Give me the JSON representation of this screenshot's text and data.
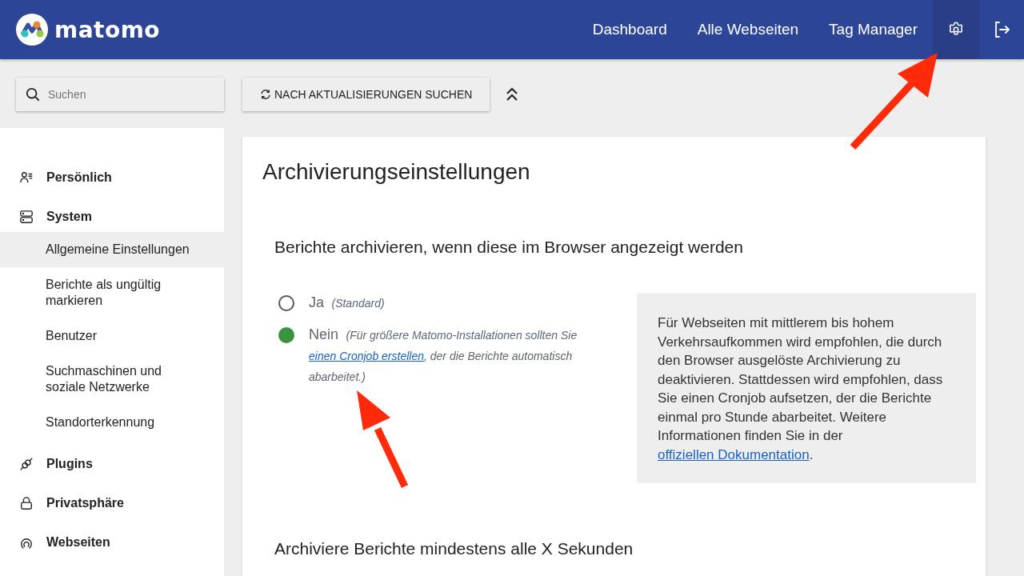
{
  "header": {
    "logo_text": "matomo",
    "nav": [
      {
        "label": "Dashboard"
      },
      {
        "label": "Alle Webseiten"
      },
      {
        "label": "Tag Manager"
      }
    ],
    "settings_active": true
  },
  "toolbar": {
    "search": {
      "placeholder": "Suchen"
    },
    "update_button": "NACH AKTUALISIERUNGEN SUCHEN"
  },
  "sidebar": {
    "sections": [
      {
        "label": "Persönlich"
      },
      {
        "label": "System",
        "items": [
          {
            "label": "Allgemeine Einstellungen",
            "selected": true
          },
          {
            "label": "Berichte als ungültig markieren",
            "selected": false
          },
          {
            "label": "Benutzer",
            "selected": false
          },
          {
            "label": "Suchmaschinen und soziale Netzwerke",
            "selected": false
          },
          {
            "label": "Standorterkennung",
            "selected": false
          }
        ]
      },
      {
        "label": "Plugins"
      },
      {
        "label": "Privatsphäre"
      },
      {
        "label": "Webseiten"
      }
    ]
  },
  "main": {
    "title": "Archivierungseinstellungen",
    "section_heading": "Berichte archivieren, wenn diese im Browser angezeigt werden",
    "options": [
      {
        "label": "Ja",
        "hint_before": "(Standard)",
        "selected": false
      },
      {
        "label": "Nein",
        "hint_before": "(Für größere Matomo-Installationen sollten Sie",
        "hint_link": "einen Cronjob erstellen",
        "hint_after": ", der die Berichte automatisch abarbeitet.)",
        "selected": true
      }
    ],
    "info": {
      "text": "Für Webseiten mit mittlerem bis hohem Verkehrsaufkommen wird empfohlen, die durch den Browser ausgelöste Archivierung zu deaktivieren. Stattdessen wird empfohlen, dass Sie einen Cronjob aufsetzen, der die Berichte einmal pro Stunde abarbeitet. Weitere Informationen finden Sie in der",
      "link": "offiziellen Dokumentation",
      "after": "."
    },
    "next_heading": "Archiviere Berichte mindestens alle X Sekunden"
  }
}
